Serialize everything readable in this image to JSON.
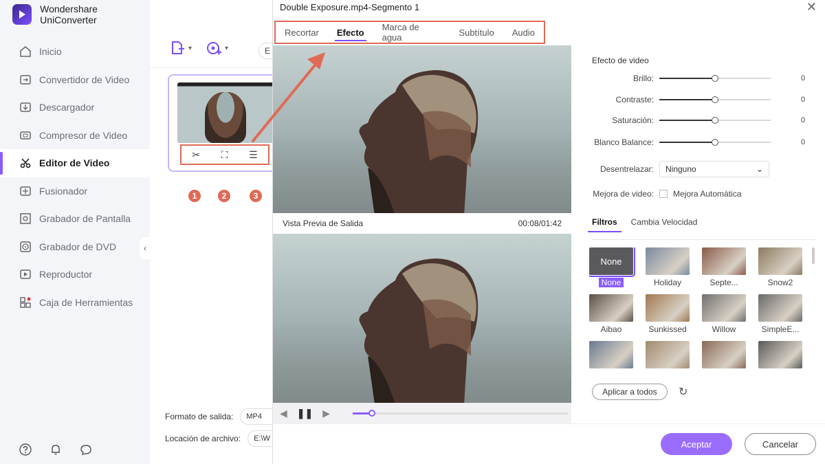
{
  "app": {
    "title": "Wondershare UniConverter"
  },
  "sidebar": {
    "items": [
      {
        "label": "Inicio",
        "icon": "home-icon"
      },
      {
        "label": "Convertidor de Video",
        "icon": "convert-icon"
      },
      {
        "label": "Descargador",
        "icon": "download-icon"
      },
      {
        "label": "Compresor de Video",
        "icon": "compress-icon"
      },
      {
        "label": "Editor de Video",
        "icon": "scissors-icon",
        "active": true
      },
      {
        "label": "Fusionador",
        "icon": "merge-icon"
      },
      {
        "label": "Grabador de Pantalla",
        "icon": "screen-record-icon"
      },
      {
        "label": "Grabador de DVD",
        "icon": "dvd-icon"
      },
      {
        "label": "Reproductor",
        "icon": "play-icon"
      },
      {
        "label": "Caja de Herramientas",
        "icon": "toolbox-icon"
      }
    ]
  },
  "main": {
    "toolbar_partial": "E",
    "badges": [
      "1",
      "2",
      "3"
    ],
    "output_format_label": "Formato de salida:",
    "output_format_value": "MP4",
    "file_location_label": "Locación de archivo:",
    "file_location_value": "E:\\W"
  },
  "dialog": {
    "title": "Double Exposure.mp4-Segmento 1",
    "tabs": [
      "Recortar",
      "Efecto",
      "Marca de agua",
      "Subtítulo",
      "Audio"
    ],
    "active_tab": "Efecto",
    "preview_label": "Vista Previa de Salida",
    "preview_time": "00:08/01:42",
    "playback_progress": 0.09,
    "effects": {
      "title": "Efecto de video",
      "sliders": [
        {
          "label": "Brillo:",
          "value": "0",
          "position": 0.5
        },
        {
          "label": "Contraste:",
          "value": "0",
          "position": 0.5
        },
        {
          "label": "Saturación:",
          "value": "0",
          "position": 0.5
        },
        {
          "label": "Blanco Balance:",
          "value": "0",
          "position": 0.5
        }
      ],
      "deinterlace_label": "Desentrelazar:",
      "deinterlace_value": "Ninguno",
      "enhance_label": "Mejora de video:",
      "enhance_option": "Mejora Automática"
    },
    "subtabs": [
      "Filtros",
      "Cambia Velocidad"
    ],
    "filters": [
      {
        "name": "None",
        "color": "#5a5a5e",
        "thumb_text": "None",
        "selected": true
      },
      {
        "name": "Holiday",
        "color": "#7a8aa0"
      },
      {
        "name": "Septe...",
        "color": "#8a5a4a"
      },
      {
        "name": "Snow2",
        "color": "#8a7a60"
      },
      {
        "name": "Aibao",
        "color": "#5a5048"
      },
      {
        "name": "Sunkissed",
        "color": "#a07850"
      },
      {
        "name": "Willow",
        "color": "#707070"
      },
      {
        "name": "SimpleE...",
        "color": "#6a6a6a"
      },
      {
        "name": "",
        "color": "#6a7a90"
      },
      {
        "name": "",
        "color": "#a08a70"
      },
      {
        "name": "",
        "color": "#8a6a58"
      },
      {
        "name": "",
        "color": "#5a5a5a"
      }
    ],
    "apply_all": "Aplicar a todos",
    "accept": "Aceptar",
    "cancel": "Cancelar"
  },
  "colors": {
    "accent": "#8a5cff",
    "annotation": "#e06a55"
  }
}
